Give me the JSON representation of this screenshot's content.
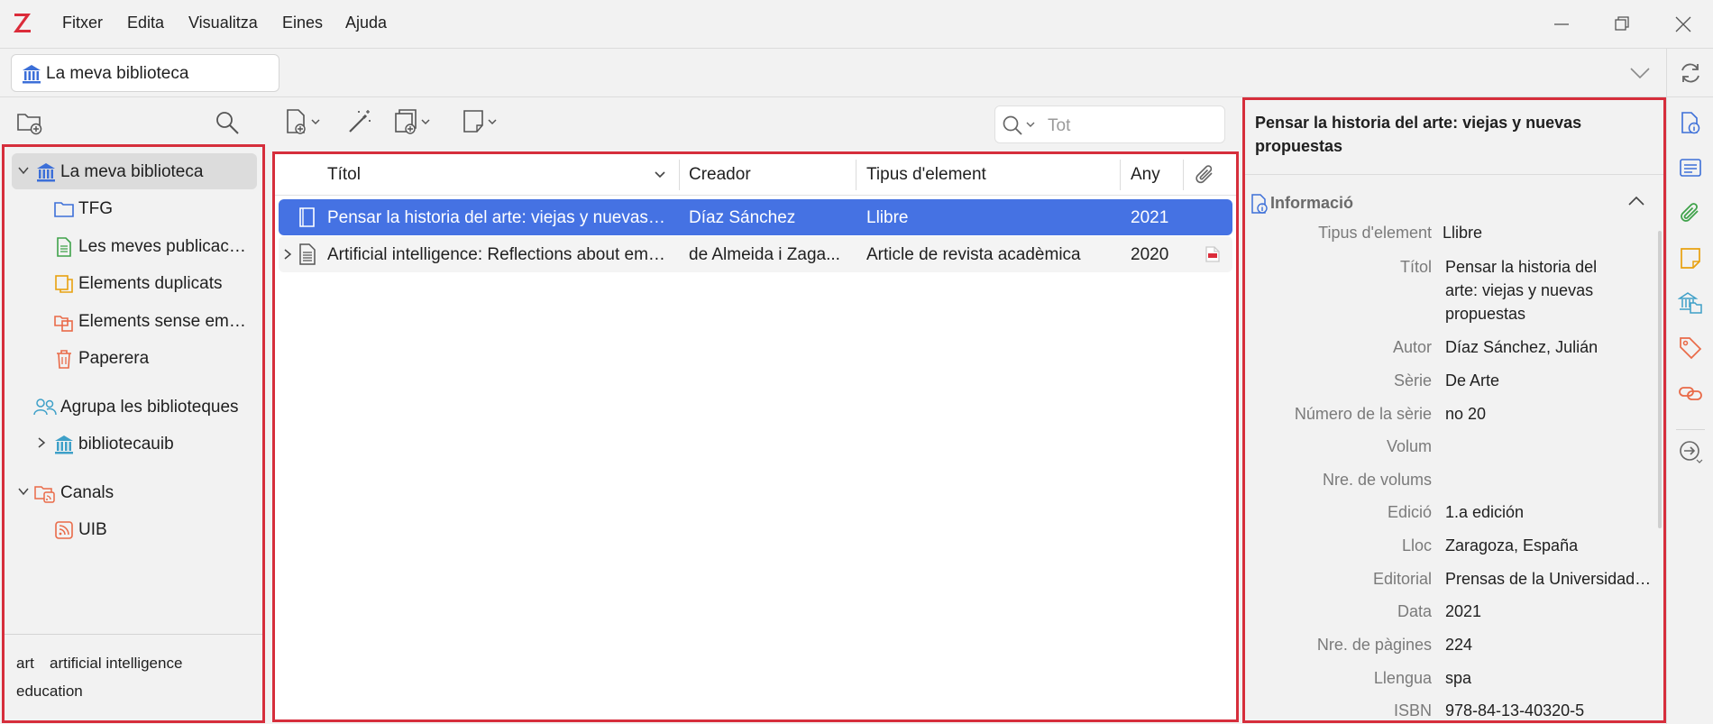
{
  "menu": {
    "items": [
      "Fitxer",
      "Edita",
      "Visualitza",
      "Eines",
      "Ajuda"
    ]
  },
  "tab": {
    "label": "La meva biblioteca"
  },
  "collections": {
    "items": [
      {
        "label": "La meva biblioteca"
      },
      {
        "label": "TFG"
      },
      {
        "label": "Les meves publicacions"
      },
      {
        "label": "Elements duplicats"
      },
      {
        "label": "Elements sense emplenar"
      },
      {
        "label": "Paperera"
      },
      {
        "label": "Agrupa les biblioteques"
      },
      {
        "label": "bibliotecauib"
      },
      {
        "label": "Canals"
      },
      {
        "label": "UIB"
      }
    ]
  },
  "tags": [
    "art",
    "artificial intelligence",
    "education"
  ],
  "search": {
    "placeholder": "Tot"
  },
  "items": {
    "columns": [
      "Títol",
      "Creador",
      "Tipus d'element",
      "Any"
    ],
    "rows": [
      {
        "title": "Pensar la historia del arte: viejas y nuevas propuestas",
        "creator": "Díaz Sánchez",
        "type": "Llibre",
        "year": "2021"
      },
      {
        "title": "Artificial intelligence: Reflections about emerging ethical issues",
        "creator": "de Almeida i Zaga...",
        "type": "Article de revista acadèmica",
        "year": "2020"
      }
    ]
  },
  "item_pane": {
    "title": "Pensar la historia del arte: viejas y nuevas propuestas",
    "section": "Informació",
    "fields": [
      {
        "label": "Tipus d'element",
        "value": "Llibre"
      },
      {
        "label": "Títol",
        "value": "Pensar la historia del arte: viejas y nuevas propuestas"
      },
      {
        "label": "Autor",
        "value": "Díaz Sánchez, Julián"
      },
      {
        "label": "Sèrie",
        "value": "De Arte"
      },
      {
        "label": "Número de la sèrie",
        "value": "no 20"
      },
      {
        "label": "Volum",
        "value": ""
      },
      {
        "label": "Nre. de volums",
        "value": ""
      },
      {
        "label": "Edició",
        "value": "1.a edición"
      },
      {
        "label": "Lloc",
        "value": "Zaragoza, España"
      },
      {
        "label": "Editorial",
        "value": "Prensas de la Universidad de Zaragoza"
      },
      {
        "label": "Data",
        "value": "2021"
      },
      {
        "label": "Nre. de pàgines",
        "value": "224"
      },
      {
        "label": "Llengua",
        "value": "spa"
      },
      {
        "label": "ISBN",
        "value": "978-84-13-40320-5"
      }
    ]
  },
  "colors": {
    "accent": "#4572e3",
    "highlight_border": "#d62e3c",
    "zotero_red": "#db2c3a"
  }
}
